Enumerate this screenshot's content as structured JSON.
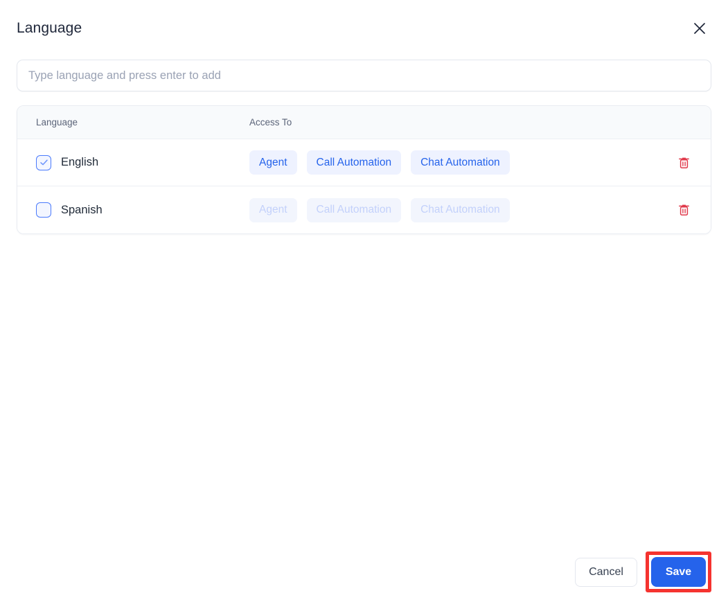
{
  "dialog": {
    "title": "Language",
    "close_icon": "close-icon"
  },
  "search": {
    "placeholder": "Type language and press enter to add",
    "value": ""
  },
  "table": {
    "columns": [
      "Language",
      "Access To"
    ],
    "rows": [
      {
        "name": "English",
        "checked": true,
        "enabled": true,
        "tags": [
          "Agent",
          "Call Automation",
          "Chat Automation"
        ],
        "delete_icon": "trash-icon"
      },
      {
        "name": "Spanish",
        "checked": false,
        "enabled": false,
        "tags": [
          "Agent",
          "Call Automation",
          "Chat Automation"
        ],
        "delete_icon": "trash-icon"
      }
    ]
  },
  "footer": {
    "cancel_label": "Cancel",
    "save_label": "Save"
  },
  "colors": {
    "accent": "#2563eb",
    "tag_bg": "#eef2ff",
    "tag_bg_disabled": "#f2f5fd",
    "tag_text_disabled": "#c3d1fb",
    "danger": "#e0394b",
    "highlight": "#f5332f",
    "header_bg": "#f8fafc",
    "title_text": "#1e2639"
  }
}
